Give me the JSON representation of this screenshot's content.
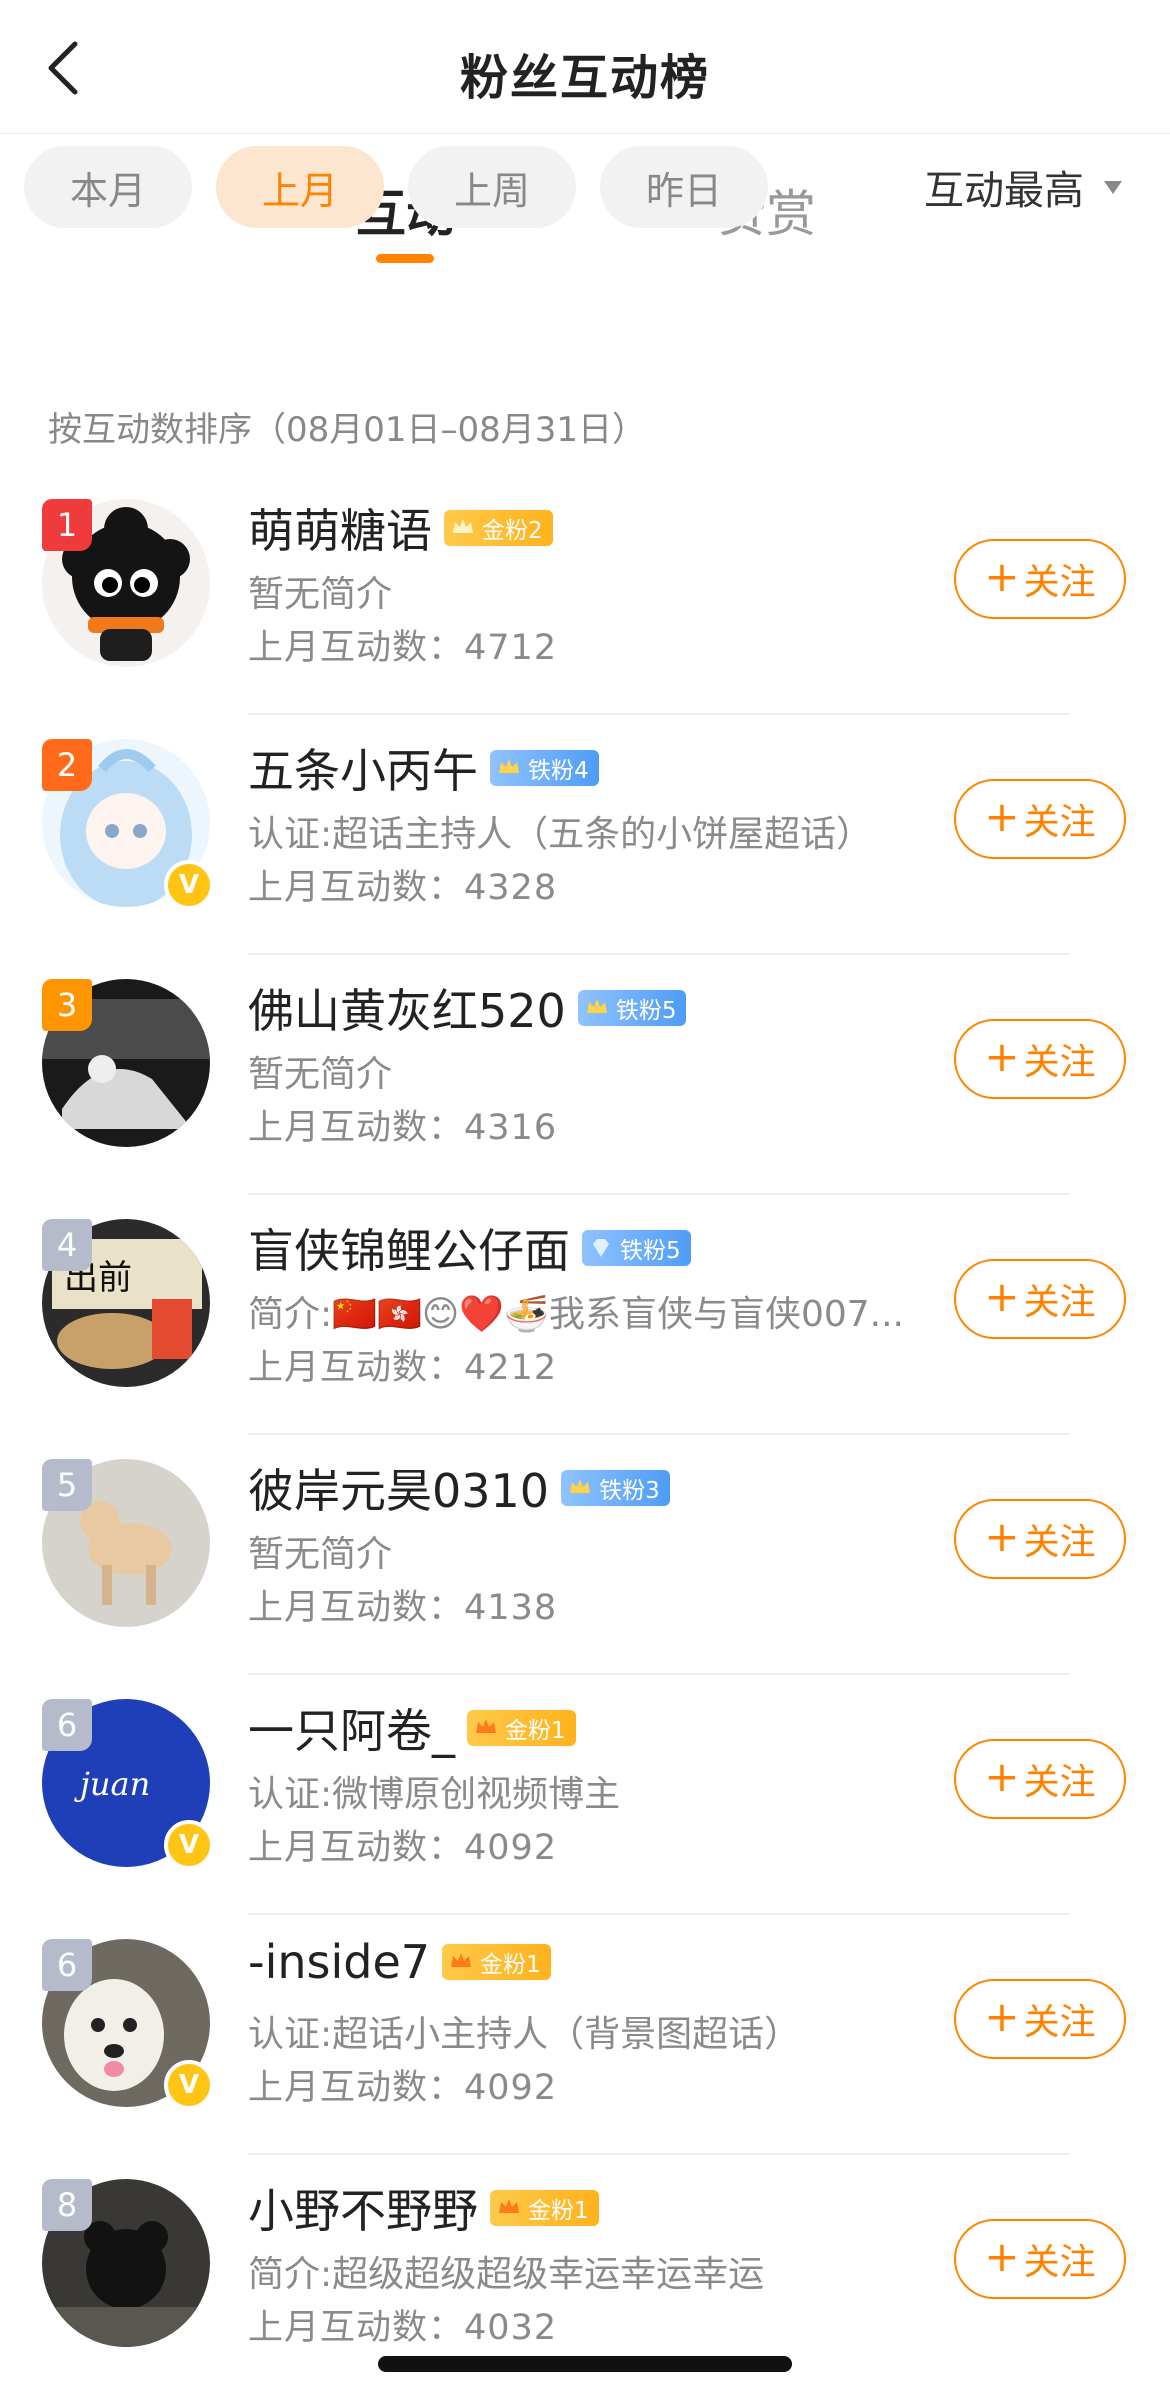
{
  "header": {
    "title": "粉丝互动榜"
  },
  "tabs": [
    "互动",
    "赞赏"
  ],
  "filters": [
    "本月",
    "上月",
    "上周",
    "昨日"
  ],
  "selected_filter": "上月",
  "sort": {
    "label": "互动最高"
  },
  "sort_note": "按互动数排序（08月01日–08月31日）",
  "count_prefix": "上月互动数：",
  "follow_label": "关注",
  "colors": {
    "accent": "#ff8200",
    "gold_badge": "#ffb21c",
    "iron_badge": "#4f9cf5"
  },
  "users": [
    {
      "rank": "1",
      "name": "萌萌糖语",
      "badge": "金粉2",
      "bio": "暂无简介",
      "count": "4712"
    },
    {
      "rank": "2",
      "name": "五条小丙午",
      "badge": "铁粉4",
      "bio": "认证:超话主持人（五条的小饼屋超话）",
      "count": "4328"
    },
    {
      "rank": "3",
      "name": "佛山黄灰红520",
      "badge": "铁粉5",
      "bio": "暂无简介",
      "count": "4316"
    },
    {
      "rank": "4",
      "name": "盲侠锦鲤公仔面",
      "badge": "铁粉5",
      "bio": "简介:🇨🇳🇭🇰😊❤️🍜我系盲侠与盲侠007...",
      "count": "4212"
    },
    {
      "rank": "5",
      "name": "彼岸元昊0310",
      "badge": "铁粉3",
      "bio": "暂无简介",
      "count": "4138"
    },
    {
      "rank": "6",
      "name": "一只阿卷_",
      "badge": "金粉1",
      "bio": "认证:微博原创视频博主",
      "count": "4092"
    },
    {
      "rank": "6",
      "name": "-inside7",
      "badge": "金粉1",
      "bio": "认证:超话小主持人（背景图超话）",
      "count": "4092"
    },
    {
      "rank": "8",
      "name": "小野不野野",
      "badge": "金粉1",
      "bio": "简介:超级超级超级幸运幸运幸运",
      "count": "4032"
    }
  ]
}
